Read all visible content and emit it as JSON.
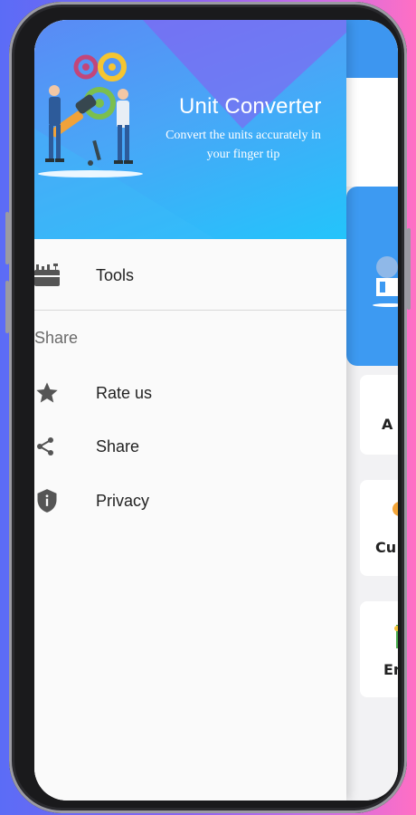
{
  "drawer": {
    "header": {
      "title": "Unit Converter",
      "subtitle": "Convert the units accurately in your finger tip"
    },
    "items": [
      {
        "icon": "toolbox-icon",
        "label": "Tools"
      }
    ],
    "share_section": {
      "title": "Share",
      "items": [
        {
          "icon": "star-icon",
          "label": "Rate us"
        },
        {
          "icon": "share-icon",
          "label": "Share"
        },
        {
          "icon": "shield-info-icon",
          "label": "Privacy"
        }
      ]
    }
  },
  "background_app": {
    "card_labels": [
      "A",
      "Cu",
      "En"
    ]
  },
  "colors": {
    "header_start": "#5a8af5",
    "header_end": "#23c4fb",
    "app_primary": "#3d96f0",
    "icon_gray": "#555555"
  }
}
